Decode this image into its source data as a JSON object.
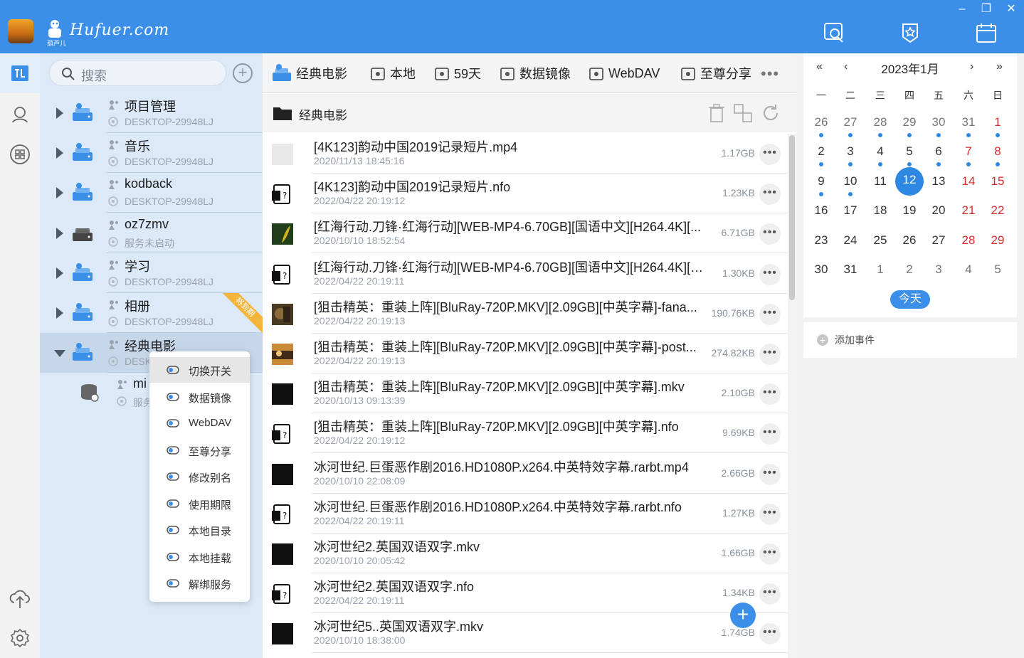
{
  "brand": {
    "text": "Hufuer.com",
    "subtitle": "葫芦儿"
  },
  "search": {
    "placeholder": "搜索"
  },
  "tree": {
    "nodes": [
      {
        "title": "项目管理",
        "sub": "DESKTOP-29948LJ",
        "expanded": false
      },
      {
        "title": "音乐",
        "sub": "DESKTOP-29948LJ",
        "expanded": false
      },
      {
        "title": "kodback",
        "sub": "DESKTOP-29948LJ",
        "expanded": false
      },
      {
        "title": "oz7zmv",
        "sub": "服务未启动",
        "expanded": false
      },
      {
        "title": "学习",
        "sub": "DESKTOP-29948LJ",
        "expanded": false
      },
      {
        "title": "相册",
        "sub": "DESKTOP-29948LJ",
        "expanded": false,
        "badge": "将到期"
      },
      {
        "title": "经典电影",
        "sub": "DESK",
        "expanded": true,
        "selected": true
      },
      {
        "title": "mi",
        "sub": "服务"
      }
    ]
  },
  "context_menu": {
    "items": [
      {
        "label": "切换开关",
        "icon": "toggle-icon",
        "highlighted": true
      },
      {
        "label": "数据镜像",
        "icon": "database-mirror-icon"
      },
      {
        "label": "WebDAV",
        "icon": "webdav-icon"
      },
      {
        "label": "至尊分享",
        "icon": "share-icon"
      },
      {
        "label": "修改别名",
        "icon": "rename-icon"
      },
      {
        "label": "使用期限",
        "icon": "calendar-clock-icon"
      },
      {
        "label": "本地目录",
        "icon": "monitor-icon"
      },
      {
        "label": "本地挂载",
        "icon": "mount-icon"
      },
      {
        "label": "解绑服务",
        "icon": "unlink-icon"
      }
    ]
  },
  "tabs": [
    {
      "label": "经典电影",
      "icon": "drive-icon"
    },
    {
      "label": "本地",
      "icon": "home-icon"
    },
    {
      "label": "59天",
      "icon": "calendar-icon"
    },
    {
      "label": "数据镜像",
      "icon": "database-icon"
    },
    {
      "label": "WebDAV",
      "icon": "webdav-icon"
    },
    {
      "label": "至尊分享",
      "icon": "share-icon"
    }
  ],
  "path": {
    "label": "经典电影"
  },
  "files": [
    {
      "name": "[4K123]韵动中国2019记录短片.mp4",
      "date": "2020/11/13 18:45:16",
      "size": "1.17GB",
      "thumb": "blank"
    },
    {
      "name": "[4K123]韵动中国2019记录短片.nfo",
      "date": "2022/04/22 20:19:12",
      "size": "1.23KB",
      "thumb": "nfo"
    },
    {
      "name": "[红海行动.刀锋·红海行动][WEB-MP4-6.70GB][国语中文][H264.4K][...",
      "date": "2020/10/10 18:52:54",
      "size": "6.71GB",
      "thumb": "green"
    },
    {
      "name": "[红海行动.刀锋·红海行动][WEB-MP4-6.70GB][国语中文][H264.4K][无...",
      "date": "2022/04/22 20:19:11",
      "size": "1.30KB",
      "thumb": "nfo"
    },
    {
      "name": "[狙击精英：重装上阵][BluRay-720P.MKV][2.09GB][中英字幕]-fana...",
      "date": "2022/04/22 20:19:13",
      "size": "190.76KB",
      "thumb": "photo"
    },
    {
      "name": "[狙击精英：重装上阵][BluRay-720P.MKV][2.09GB][中英字幕]-post...",
      "date": "2022/04/22 20:19:13",
      "size": "274.82KB",
      "thumb": "poster"
    },
    {
      "name": "[狙击精英：重装上阵][BluRay-720P.MKV][2.09GB][中英字幕].mkv",
      "date": "2020/10/13 09:13:39",
      "size": "2.10GB",
      "thumb": "black"
    },
    {
      "name": "[狙击精英：重装上阵][BluRay-720P.MKV][2.09GB][中英字幕].nfo",
      "date": "2022/04/22 20:19:12",
      "size": "9.69KB",
      "thumb": "nfo"
    },
    {
      "name": "冰河世纪.巨蛋恶作剧2016.HD1080P.x264.中英特效字幕.rarbt.mp4",
      "date": "2020/10/10 22:08:09",
      "size": "2.66GB",
      "thumb": "black"
    },
    {
      "name": "冰河世纪.巨蛋恶作剧2016.HD1080P.x264.中英特效字幕.rarbt.nfo",
      "date": "2022/04/22 20:19:11",
      "size": "1.27KB",
      "thumb": "nfo"
    },
    {
      "name": "冰河世纪2.英国双语双字.mkv",
      "date": "2020/10/10 20:05:42",
      "size": "1.66GB",
      "thumb": "black"
    },
    {
      "name": "冰河世纪2.英国双语双字.nfo",
      "date": "2022/04/22 20:19:11",
      "size": "1.34KB",
      "thumb": "nfo"
    },
    {
      "name": "冰河世纪5..英国双语双字.mkv",
      "date": "2020/10/10 18:38:00",
      "size": "1.74GB",
      "thumb": "black"
    }
  ],
  "calendar": {
    "title": "2023年1月",
    "nav": {
      "prev_year": "«",
      "prev_month": "‹",
      "next_month": "›",
      "next_year": "»"
    },
    "weekdays": [
      "一",
      "二",
      "三",
      "四",
      "五",
      "六",
      "日"
    ],
    "weeks": [
      [
        {
          "d": "26",
          "o": 1,
          "dot": 1
        },
        {
          "d": "27",
          "o": 1,
          "dot": 1
        },
        {
          "d": "28",
          "o": 1,
          "dot": 1
        },
        {
          "d": "29",
          "o": 1,
          "dot": 1
        },
        {
          "d": "30",
          "o": 1,
          "dot": 1
        },
        {
          "d": "31",
          "o": 1,
          "dot": 1
        },
        {
          "d": "1",
          "r": 1,
          "dot": 1
        }
      ],
      [
        {
          "d": "2",
          "dot": 1
        },
        {
          "d": "3",
          "dot": 1
        },
        {
          "d": "4",
          "dot": 1
        },
        {
          "d": "5",
          "dot": 1
        },
        {
          "d": "6",
          "dot": 1
        },
        {
          "d": "7",
          "r": 1,
          "dot": 1
        },
        {
          "d": "8",
          "r": 1,
          "dot": 1
        }
      ],
      [
        {
          "d": "9",
          "dot": 1
        },
        {
          "d": "10",
          "dot": 1
        },
        {
          "d": "11"
        },
        {
          "d": "12",
          "t": 1
        },
        {
          "d": "13"
        },
        {
          "d": "14",
          "r": 1
        },
        {
          "d": "15",
          "r": 1
        }
      ],
      [
        {
          "d": "16"
        },
        {
          "d": "17"
        },
        {
          "d": "18"
        },
        {
          "d": "19"
        },
        {
          "d": "20"
        },
        {
          "d": "21",
          "r": 1
        },
        {
          "d": "22",
          "r": 1
        }
      ],
      [
        {
          "d": "23"
        },
        {
          "d": "24"
        },
        {
          "d": "25"
        },
        {
          "d": "26"
        },
        {
          "d": "27"
        },
        {
          "d": "28",
          "r": 1
        },
        {
          "d": "29",
          "r": 1
        }
      ],
      [
        {
          "d": "30"
        },
        {
          "d": "31"
        },
        {
          "d": "1",
          "o": 1
        },
        {
          "d": "2",
          "o": 1
        },
        {
          "d": "3",
          "o": 1
        },
        {
          "d": "4",
          "o": 1
        },
        {
          "d": "5",
          "o": 1
        }
      ]
    ],
    "today_label": "今天"
  },
  "events": {
    "add_label": "添加事件"
  },
  "colors": {
    "accent": "#3b8fe8",
    "weekend": "#d92b2b",
    "sidebar": "#dbe9f9"
  }
}
